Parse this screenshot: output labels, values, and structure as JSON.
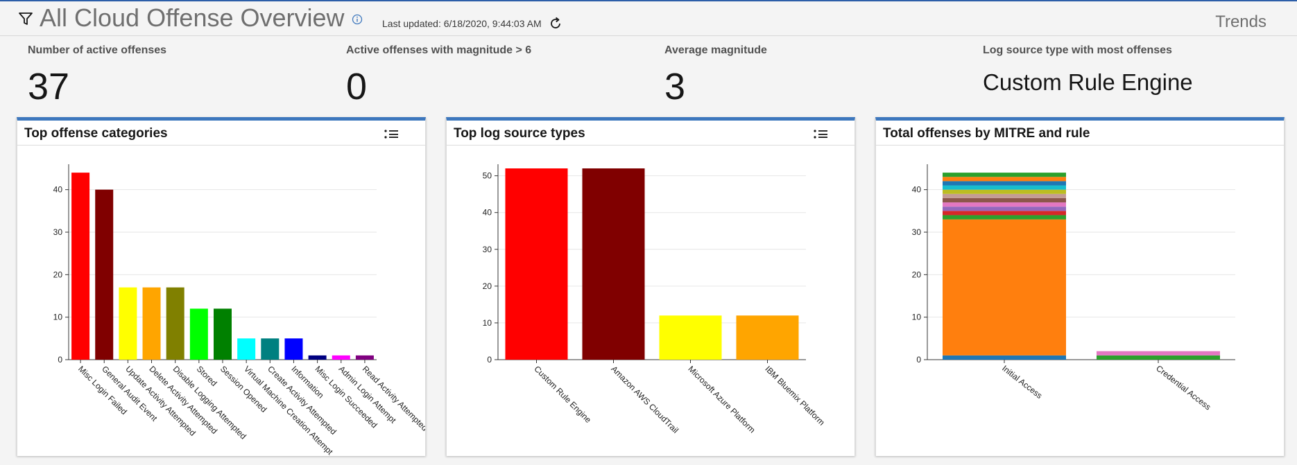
{
  "header": {
    "title": "All Cloud Offense Overview",
    "last_updated": "Last updated: 6/18/2020, 9:44:03 AM",
    "trends_label": "Trends"
  },
  "stats": [
    {
      "label": "Number of active offenses",
      "value": "37"
    },
    {
      "label": "Active offenses with magnitude > 6",
      "value": "0"
    },
    {
      "label": "Average magnitude",
      "value": "3"
    },
    {
      "label": "Log source type with most offenses",
      "value": "Custom Rule Engine"
    }
  ],
  "panels": [
    {
      "title": "Top offense categories"
    },
    {
      "title": "Top log source types"
    },
    {
      "title": "Total offenses by MITRE and rule"
    }
  ],
  "chart_data": [
    {
      "type": "bar",
      "categories": [
        "Misc Login Failed",
        "General Audit Event",
        "Update Activity Attempted",
        "Delete Activity Attempted",
        "Disable Logging Attempted",
        "Stored",
        "Session Opened",
        "Virtual Machine Creation Attempt",
        "Create Activity Attempted",
        "Information",
        "Misc Login Succeeded",
        "Admin Login Attempt",
        "Read Activity Attempted"
      ],
      "values": [
        44,
        40,
        17,
        17,
        17,
        12,
        12,
        5,
        5,
        5,
        1,
        1,
        1
      ],
      "colors": [
        "#ff0000",
        "#800000",
        "#ffff00",
        "#ffa500",
        "#808000",
        "#00ff00",
        "#008000",
        "#00ffff",
        "#008080",
        "#0000ff",
        "#000080",
        "#ff00ff",
        "#800080"
      ],
      "yticks": [
        0,
        10,
        20,
        30,
        40
      ],
      "ylim": [
        0,
        45
      ],
      "grid": true
    },
    {
      "type": "bar",
      "categories": [
        "Custom Rule Engine",
        "Amazon AWS CloudTrail",
        "Microsoft Azure Platform",
        "IBM Bluemix Platform"
      ],
      "values": [
        52,
        52,
        12,
        12
      ],
      "colors": [
        "#ff0000",
        "#800000",
        "#ffff00",
        "#ffa500"
      ],
      "yticks": [
        0,
        10,
        20,
        30,
        40,
        50
      ],
      "ylim": [
        0,
        52
      ],
      "grid": true
    },
    {
      "type": "bar",
      "stacked": true,
      "categories": [
        "Initial Access",
        "Credential Access"
      ],
      "stacks": [
        [
          {
            "value": 1,
            "color": "#1f77b4"
          },
          {
            "value": 32,
            "color": "#ff7f0e"
          },
          {
            "value": 1,
            "color": "#2ca02c"
          },
          {
            "value": 1,
            "color": "#d62728"
          },
          {
            "value": 1,
            "color": "#9467bd"
          },
          {
            "value": 1,
            "color": "#e377c2"
          },
          {
            "value": 1,
            "color": "#8c564b"
          },
          {
            "value": 1,
            "color": "#c49c94"
          },
          {
            "value": 1,
            "color": "#bcbd22"
          },
          {
            "value": 1,
            "color": "#17becf"
          },
          {
            "value": 1,
            "color": "#1f77b4"
          },
          {
            "value": 1,
            "color": "#ff7f0e"
          },
          {
            "value": 1,
            "color": "#2ca02c"
          }
        ],
        [
          {
            "value": 1,
            "color": "#2ca02c"
          },
          {
            "value": 1,
            "color": "#e377c2"
          }
        ]
      ],
      "yticks": [
        0,
        10,
        20,
        30,
        40
      ],
      "ylim": [
        0,
        45
      ],
      "grid": true
    }
  ]
}
